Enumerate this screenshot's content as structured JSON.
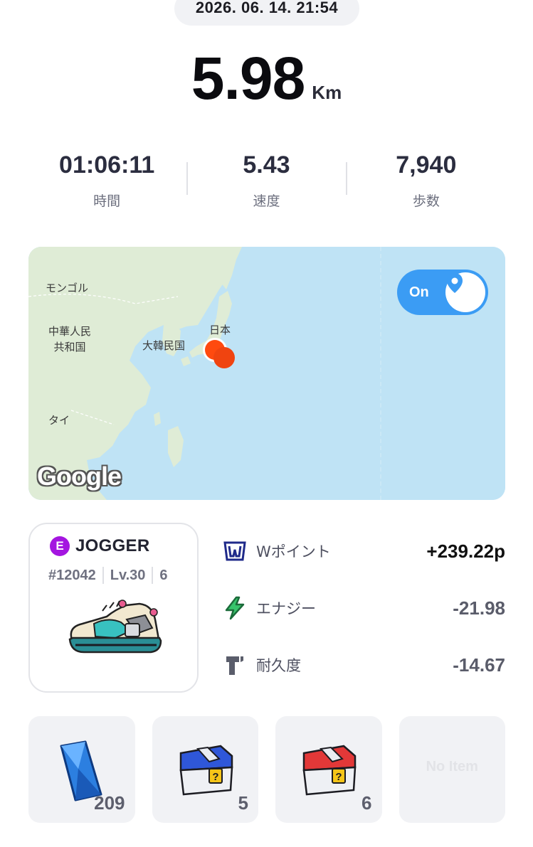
{
  "header": {
    "datetime": "2026. 06. 14. 21:54"
  },
  "distance": {
    "value": "5.98",
    "unit": "Km"
  },
  "stats": [
    {
      "value": "01:06:11",
      "label": "時間"
    },
    {
      "value": "5.43",
      "label": "速度"
    },
    {
      "value": "7,940",
      "label": "歩数"
    }
  ],
  "map": {
    "labels": [
      "モンゴル",
      "中華人民\n共和国",
      "大韓民国",
      "日本",
      "タイ"
    ],
    "toggle_label": "On",
    "logo": "Google",
    "colors": {
      "water": "#bfe3f5",
      "land": "#dfecd6",
      "marker": "#ff4a0f",
      "toggle": "#3b9cf4"
    }
  },
  "shoe": {
    "badge": "E",
    "type": "JOGGER",
    "id": "#12042",
    "level": "Lv.30",
    "mint_icon": "6",
    "badge_color": "#a415e0"
  },
  "rewards": [
    {
      "icon": "w-point-icon",
      "label": "Wポイント",
      "value": "+239.22p"
    },
    {
      "icon": "energy-icon",
      "label": "エナジー",
      "value": "-21.98"
    },
    {
      "icon": "durability-icon",
      "label": "耐久度",
      "value": "-14.67"
    }
  ],
  "items": [
    {
      "icon": "blue-crystal-icon",
      "count": "209"
    },
    {
      "icon": "blue-mystery-box-icon",
      "count": "5"
    },
    {
      "icon": "red-mystery-box-icon",
      "count": "6"
    },
    {
      "icon": "",
      "empty_label": "No Item"
    }
  ]
}
